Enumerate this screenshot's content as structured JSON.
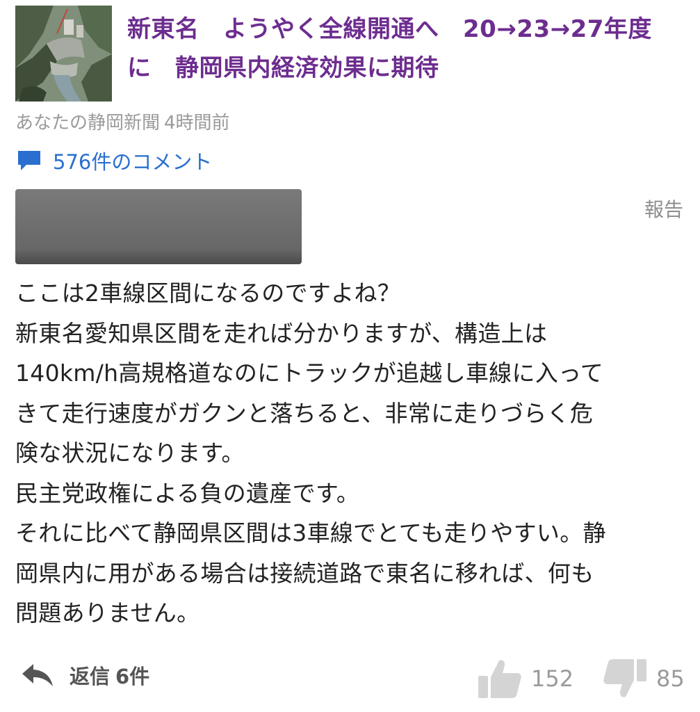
{
  "article": {
    "title_line1": "新東名　ようやく全線開通へ　20→23→27年度",
    "title_line2": "に　静岡県内経済効果に期待",
    "source": "あなたの静岡新聞",
    "time": "4時間前"
  },
  "comments_link": {
    "label": "576件のコメント",
    "icon": "speech-bubble-icon",
    "color": "#2a6fcf"
  },
  "comment": {
    "report_label": "報告",
    "lines": [
      "ここは2車線区間になるのですよね？",
      "新東名愛知県区間を走れば分かりますが、構造上は",
      "140km/h高規格道なのにトラックが追越し車線に入って",
      "きて走行速度がガクンと落ちると、非常に走りづらく危",
      "険な状況になります。",
      "民主党政権による負の遺産です。",
      "それに比べて静岡県区間は3車線でとても走りやすい。静",
      "岡県内に用がある場合は接続道路で東名に移れば、何も",
      "問題ありません。"
    ]
  },
  "footer": {
    "reply_label": "返信",
    "reply_count": "6件",
    "likes": "152",
    "dislikes": "85"
  },
  "colors": {
    "title": "#6d2d8f",
    "meta": "#9a9a9a",
    "link": "#2a6fcf"
  }
}
